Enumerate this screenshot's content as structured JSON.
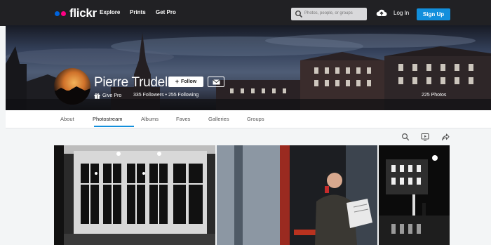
{
  "nav": {
    "logo": "flickr",
    "links": [
      "Explore",
      "Prints",
      "Get Pro"
    ],
    "search_placeholder": "Photos, people, or groups",
    "login": "Log In",
    "signup": "Sign Up"
  },
  "profile": {
    "name": "Pierre Trudel",
    "follow_label": "Follow",
    "give_pro": "Give Pro",
    "followers": "335 Followers",
    "separator": "•",
    "following": "255 Following",
    "photos": "225 Photos"
  },
  "tabs": [
    "About",
    "Photostream",
    "Albums",
    "Faves",
    "Galleries",
    "Groups"
  ],
  "active_tab": "Photostream",
  "colors": {
    "accent": "#128fdc",
    "nav_bg": "#212124",
    "logo_blue": "#0063dc",
    "logo_pink": "#ff0084"
  },
  "icons": [
    "search-icon",
    "slideshow-icon",
    "share-icon"
  ]
}
